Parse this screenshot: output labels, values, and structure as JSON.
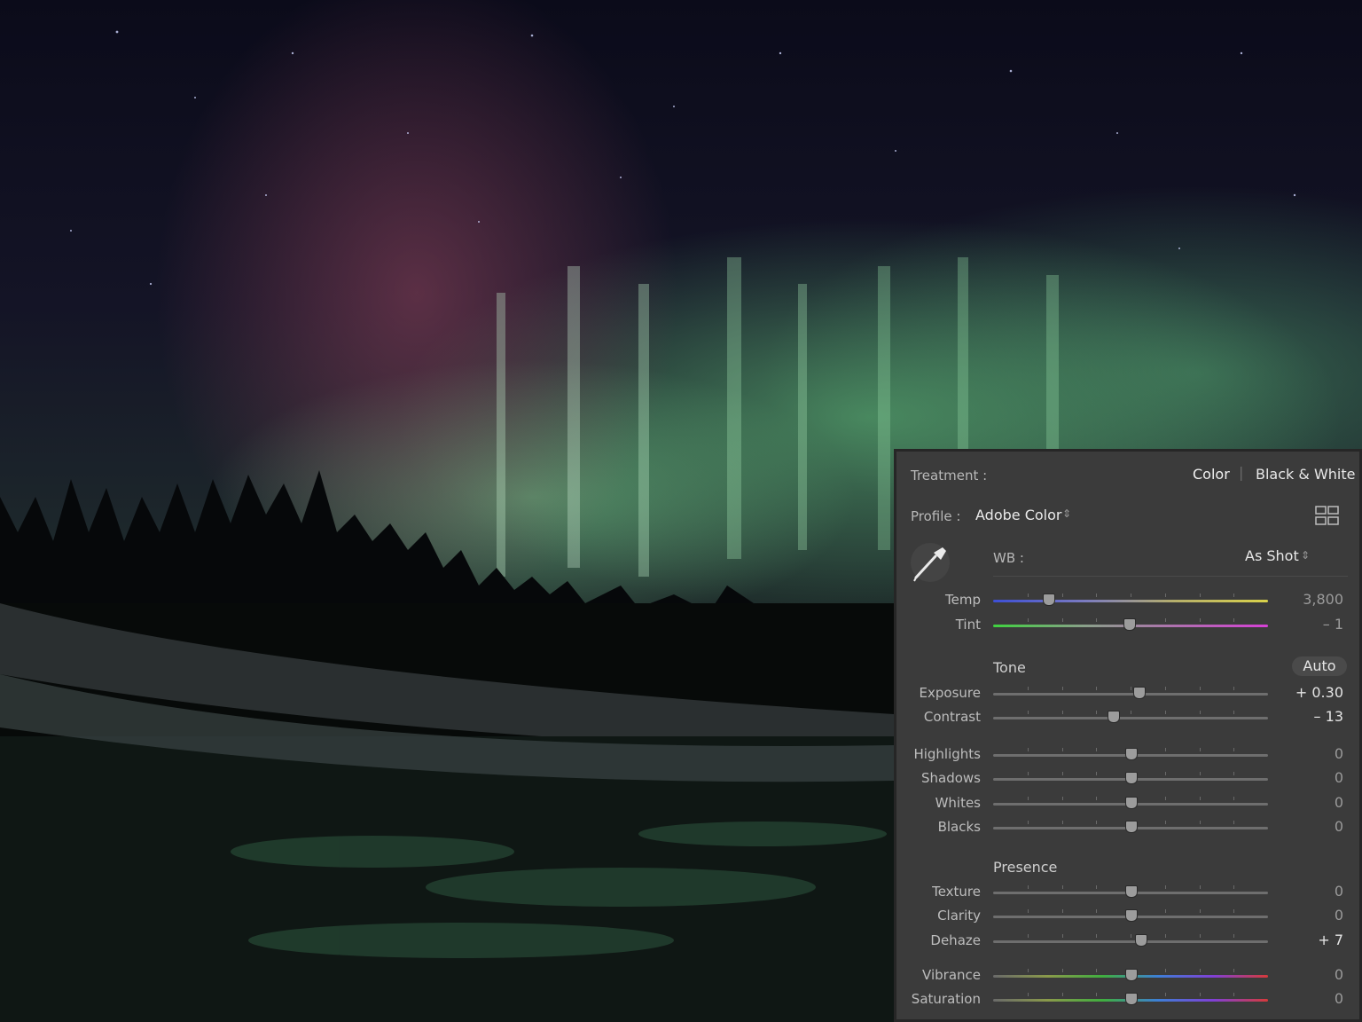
{
  "treatment": {
    "label": "Treatment :",
    "options": [
      "Color",
      "Black & White"
    ],
    "separator": "|"
  },
  "profile": {
    "label": "Profile :",
    "value": "Adobe Color",
    "stepper": "⇕"
  },
  "wb": {
    "label": "WB :",
    "value": "As Shot",
    "stepper": "⇕"
  },
  "sliders": {
    "temp": {
      "label": "Temp",
      "value": "3,800",
      "pos": 0.2
    },
    "tint": {
      "label": "Tint",
      "value": "– 1",
      "pos": 0.495
    },
    "exposure": {
      "label": "Exposure",
      "value": "+ 0.30",
      "pos": 0.53
    },
    "contrast": {
      "label": "Contrast",
      "value": "– 13",
      "pos": 0.435
    },
    "highlights": {
      "label": "Highlights",
      "value": "0",
      "pos": 0.5
    },
    "shadows": {
      "label": "Shadows",
      "value": "0",
      "pos": 0.5
    },
    "whites": {
      "label": "Whites",
      "value": "0",
      "pos": 0.5
    },
    "blacks": {
      "label": "Blacks",
      "value": "0",
      "pos": 0.5
    },
    "texture": {
      "label": "Texture",
      "value": "0",
      "pos": 0.5
    },
    "clarity": {
      "label": "Clarity",
      "value": "0",
      "pos": 0.5
    },
    "dehaze": {
      "label": "Dehaze",
      "value": "+ 7",
      "pos": 0.535
    },
    "vibrance": {
      "label": "Vibrance",
      "value": "0",
      "pos": 0.5
    },
    "saturation": {
      "label": "Saturation",
      "value": "0",
      "pos": 0.5
    }
  },
  "tone": {
    "heading": "Tone",
    "auto": "Auto"
  },
  "presence": {
    "heading": "Presence"
  },
  "colors": {
    "panel_bg": "#3a3a3a",
    "temp_gradient": [
      "#3d4fd6",
      "#d9d24a"
    ],
    "tint_gradient": [
      "#3fd23f",
      "#d640d6"
    ],
    "vib_gradient": [
      "#707070",
      "#3fae3f",
      "#3d4fd6",
      "#d63a3a"
    ]
  }
}
